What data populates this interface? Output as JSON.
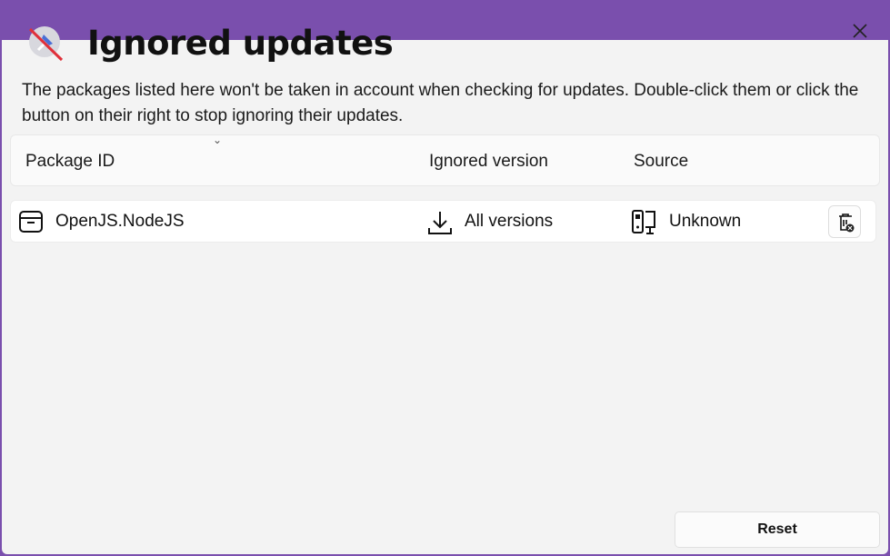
{
  "dialog": {
    "title": "Ignored updates",
    "description": "The packages listed here won't be taken in account when checking for updates. Double-click them or click the button on their right to stop ignoring their updates.",
    "close_icon": "close-icon",
    "accent": "#7a4fad"
  },
  "table": {
    "columns": [
      "Package ID",
      "Ignored version",
      "Source"
    ],
    "rows": [
      {
        "package_id": "OpenJS.NodeJS",
        "ignored_version": "All versions",
        "source": "Unknown",
        "icons": [
          "package-icon",
          "download-icon",
          "computer-icon",
          "delete-icon"
        ]
      }
    ]
  },
  "footer": {
    "reset_label": "Reset"
  }
}
